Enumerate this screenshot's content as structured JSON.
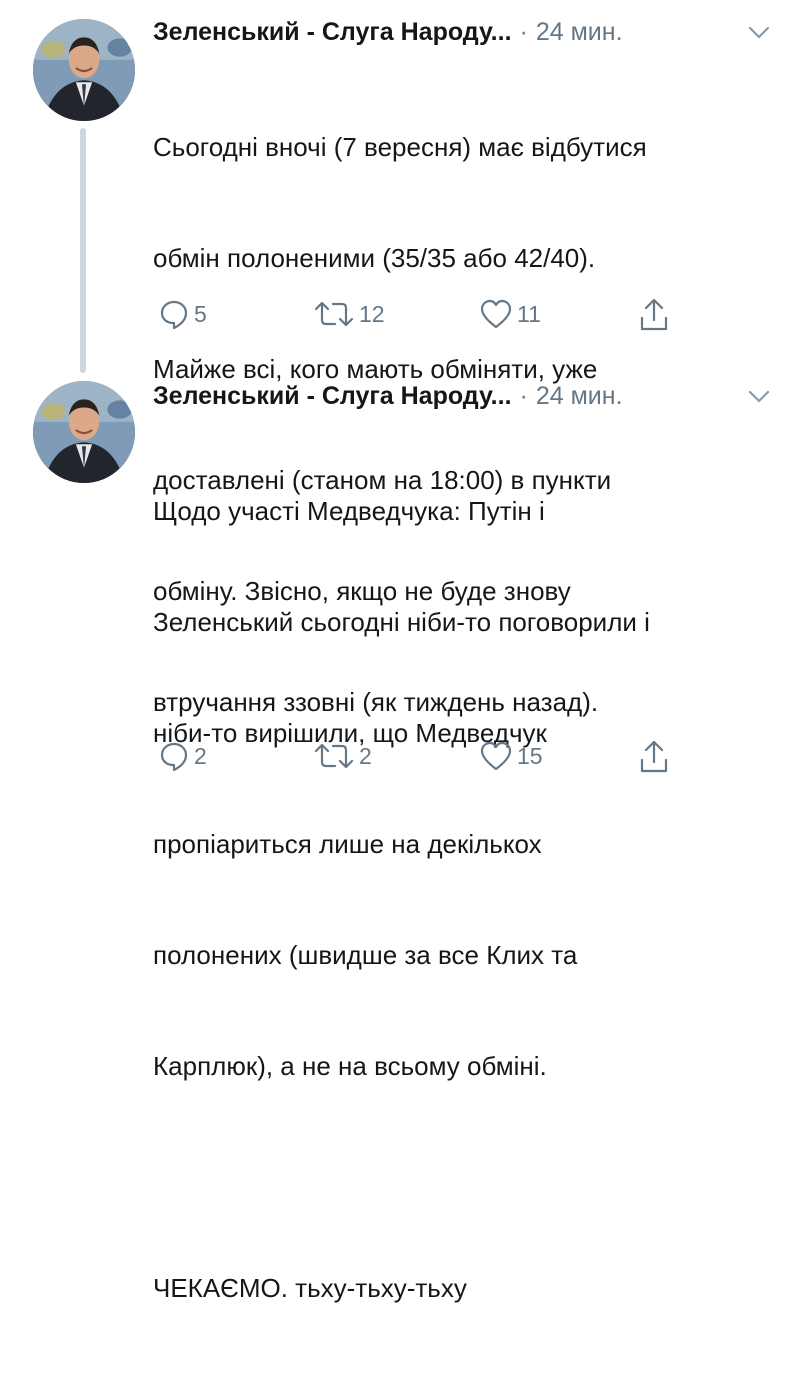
{
  "tweets": [
    {
      "author": "Зеленський - Слуга Народу...",
      "separator": "·",
      "time": "24 мин.",
      "text": "Сьогодні вночі (7 вересня) має відбутися обмін полоненими (35/35 або 42/40). Майже всі, кого мають обміняти, уже доставлені (станом на 18:00) в пункти обміну. Звісно, якщо не буде знову втручання ззовні (як тиждень назад).",
      "lines": [
        "Сьогодні вночі (7 вересня) має відбутися",
        "обмін полоненими (35/35 або 42/40).",
        "Майже всі, кого мають обміняти, уже",
        "доставлені (станом на 18:00) в пункти",
        "обміну. Звісно, якщо не буде знову",
        "втручання ззовні (як тиждень назад)."
      ],
      "replies": "5",
      "retweets": "12",
      "likes": "11"
    },
    {
      "author": "Зеленський - Слуга Народу...",
      "separator": "·",
      "time": "24 мин.",
      "lines": [
        "Щодо участі Медведчука: Путін і",
        "Зеленський сьогодні ніби-то поговорили і",
        "ніби-то вирішили, що Медведчук",
        "пропіариться лише на декількох",
        "полонених (швидше за все Клих та",
        "Карплюк), а не на всьому обміні.",
        "",
        "ЧЕКАЄМО. тьху-тьху-тьху"
      ],
      "replies": "2",
      "retweets": "2",
      "likes": "15"
    }
  ],
  "icons": {
    "reply": "reply-icon",
    "retweet": "retweet-icon",
    "like": "heart-icon",
    "share": "share-icon",
    "more": "chevron-down-icon"
  },
  "colors": {
    "text": "#14171a",
    "muted": "#657786",
    "thread_line": "#ccd6dd"
  }
}
